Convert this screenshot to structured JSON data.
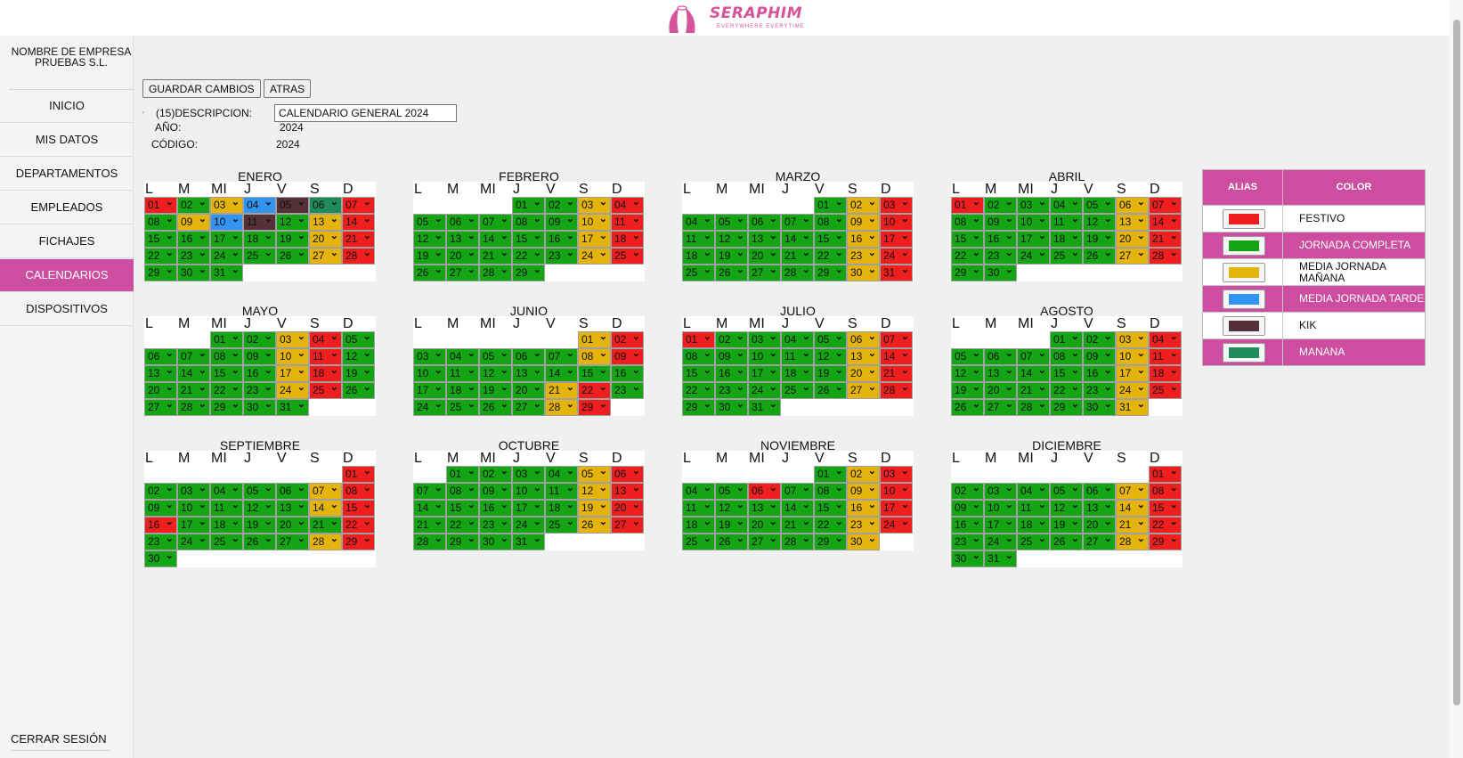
{
  "brand": {
    "name": "SERAPHIM",
    "tagline": "EVERYWHERE EVERYTIME"
  },
  "sidebar": {
    "company": "NOMBRE DE EMPRESA PRUEBAS S.L.",
    "items": [
      {
        "label": "INICIO"
      },
      {
        "label": "MIS DATOS"
      },
      {
        "label": "DEPARTAMENTOS"
      },
      {
        "label": "EMPLEADOS"
      },
      {
        "label": "FICHAJES"
      },
      {
        "label": "CALENDARIOS",
        "active": true
      },
      {
        "label": "DISPOSITIVOS"
      }
    ],
    "logout": "CERRAR SESIÓN"
  },
  "toolbar": {
    "save": "GUARDAR CAMBIOS",
    "back": "ATRAS"
  },
  "form": {
    "descripcion_label": "(15)DESCRIPCION:",
    "descripcion_value": "CALENDARIO GENERAL 2024",
    "anio_label": "AÑO:",
    "anio_value": "2024",
    "codigo_label": "CÓDIGO:",
    "codigo_value": "2024"
  },
  "weekday_headers": [
    "L",
    "M",
    "MI",
    "J",
    "V",
    "S",
    "D"
  ],
  "colors": {
    "F": "#f01f1f",
    "C": "#14a514",
    "M": "#e4b40c",
    "T": "#3494f2",
    "K": "#563038",
    "W": "#1f8a5a",
    "accent": "#cd4ea0"
  },
  "months": [
    {
      "name": "ENERO",
      "offset": 0,
      "days": "FCMTKWFCMTKCMFCCCCCMFCCCCCMFCCC"
    },
    {
      "name": "FEBRERO",
      "offset": 3,
      "days": "CCMFCCCCCMFCCCCCMFCCCCCMFCCCC"
    },
    {
      "name": "MARZO",
      "offset": 4,
      "days": "CMFCCCCCMFCCCCCMFCCCCCMFCCCCCMF"
    },
    {
      "name": "ABRIL",
      "offset": 0,
      "days": "FCCCCMFCCCCCMFCCCCCMFCCCCCMFCC"
    },
    {
      "name": "MAYO",
      "offset": 2,
      "days": "CCMFCCCCCMFCCCCCMFCCCCCMFCCCCCC"
    },
    {
      "name": "JUNIO",
      "offset": 5,
      "days": "MFCCCCCMFCCCCCCCCCCCMFCCCCCMF"
    },
    {
      "name": "JULIO",
      "offset": 0,
      "days": "FCCCCMFCCCCCMFCCCCCMFCCCCCMFCCC"
    },
    {
      "name": "AGOSTO",
      "offset": 3,
      "days": "CCMFCCCCCMFCCCCCMFCCCCCMFCCCCCM"
    },
    {
      "name": "SEPTIEMBRE",
      "offset": 6,
      "days": "FCCCCCMFCCCCCMFFCCCCCFCCCCCMFC"
    },
    {
      "name": "OCTUBRE",
      "offset": 1,
      "days": "CCCCMFCCCCCMFCCCCCMFCCCCCMFCCCC"
    },
    {
      "name": "NOVIEMBRE",
      "offset": 4,
      "days": "CMFCCFCCMFCCCCCMFCCCCCMFCCCCCM"
    },
    {
      "name": "DICIEMBRE",
      "offset": 6,
      "days": "FCCCCCMFCCCCCMFCCCCCMFCCCCCMFCC"
    }
  ],
  "legend": {
    "alias_header": "ALIAS",
    "color_header": "COLOR",
    "rows": [
      {
        "name": "FESTIVO",
        "code": "F"
      },
      {
        "name": "JORNADA COMPLETA",
        "code": "C"
      },
      {
        "name": "MEDIA JORNADA MAÑANA",
        "code": "M"
      },
      {
        "name": "MEDIA JORNADA TARDE",
        "code": "T"
      },
      {
        "name": "KIK",
        "code": "K"
      },
      {
        "name": "MANANA",
        "code": "W"
      }
    ]
  }
}
